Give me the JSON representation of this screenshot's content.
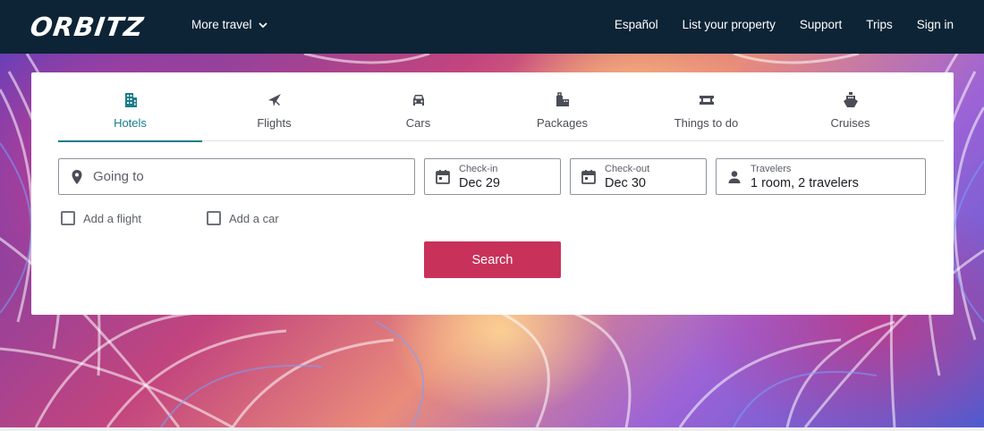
{
  "header": {
    "logo": "ORBITZ",
    "more_travel": "More travel",
    "nav": [
      "Español",
      "List your property",
      "Support",
      "Trips",
      "Sign in"
    ]
  },
  "tabs": [
    {
      "label": "Hotels",
      "icon": "hotel-icon",
      "active": true
    },
    {
      "label": "Flights",
      "icon": "airplane-icon",
      "active": false
    },
    {
      "label": "Cars",
      "icon": "car-icon",
      "active": false
    },
    {
      "label": "Packages",
      "icon": "packages-icon",
      "active": false
    },
    {
      "label": "Things to do",
      "icon": "ticket-icon",
      "active": false
    },
    {
      "label": "Cruises",
      "icon": "ship-icon",
      "active": false
    }
  ],
  "search": {
    "destination_placeholder": "Going to",
    "checkin_label": "Check-in",
    "checkin_value": "Dec 29",
    "checkout_label": "Check-out",
    "checkout_value": "Dec 30",
    "travelers_label": "Travelers",
    "travelers_value": "1 room, 2 travelers",
    "add_flight": "Add a flight",
    "add_car": "Add a car",
    "button": "Search"
  },
  "colors": {
    "header_bg": "#0d2436",
    "accent_teal": "#1a7d8a",
    "search_button": "#c8325a"
  }
}
